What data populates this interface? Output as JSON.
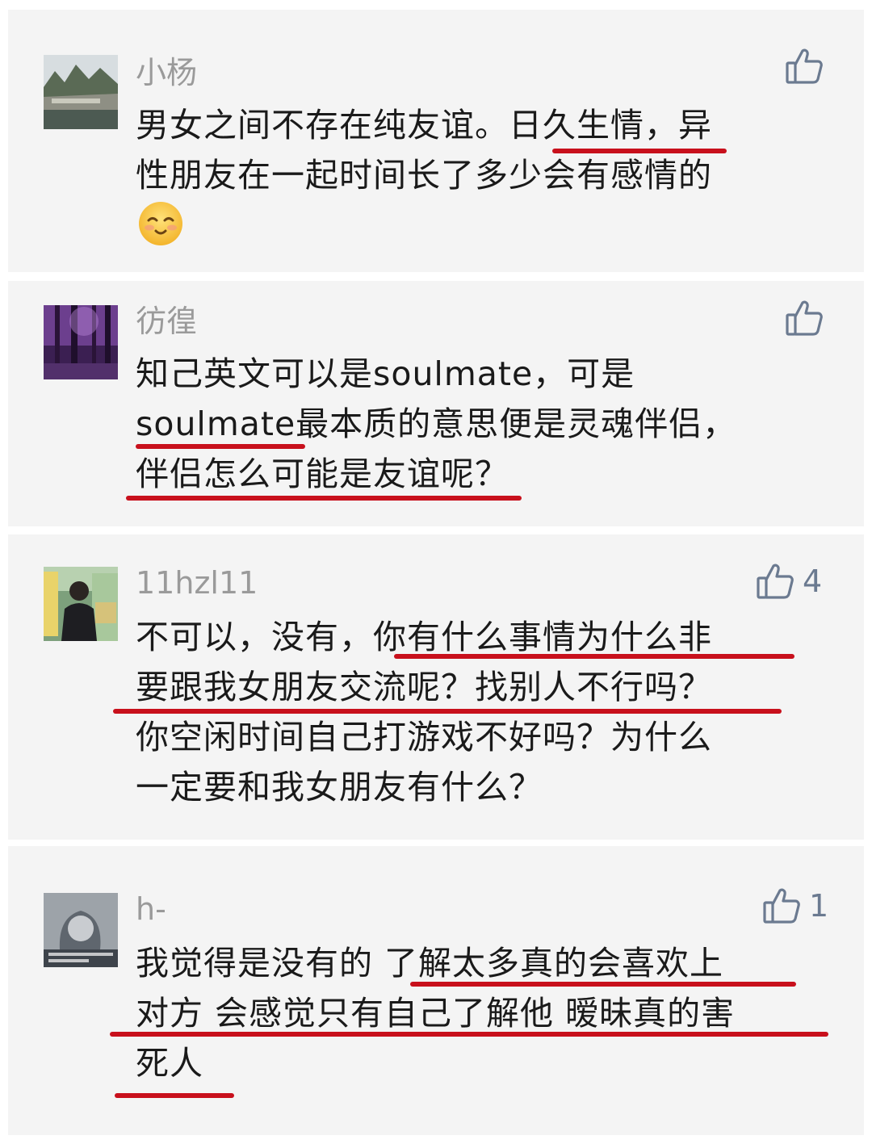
{
  "colors": {
    "card_bg": "#f4f4f4",
    "username": "#9a9a9a",
    "text": "#1a1a1a",
    "like_icon": "#6b7a90",
    "underline": "#c8101c"
  },
  "comments": [
    {
      "username": "小杨",
      "like_count": "",
      "lines": [
        "男女之间不存在纯友谊。日久生情，异",
        "性朋友在一起时间长了多少会有感情的"
      ],
      "emoji": "smiling-face-emoji"
    },
    {
      "username": "彷徨",
      "like_count": "",
      "lines": [
        "知己英文可以是soulmate，可是",
        "soulmate最本质的意思便是灵魂伴侣，",
        "伴侣怎么可能是友谊呢？"
      ]
    },
    {
      "username": "11hzl11",
      "like_count": "4",
      "lines": [
        "不可以，没有，你有什么事情为什么非",
        "要跟我女朋友交流呢？找别人不行吗？",
        "你空闲时间自己打游戏不好吗？为什么",
        "一定要和我女朋友有什么？"
      ]
    },
    {
      "username": "h-",
      "like_count": "1",
      "lines": [
        "我觉得是没有的 了解太多真的会喜欢上",
        "对方 会感觉只有自己了解他 暧昧真的害",
        "死人"
      ]
    }
  ]
}
